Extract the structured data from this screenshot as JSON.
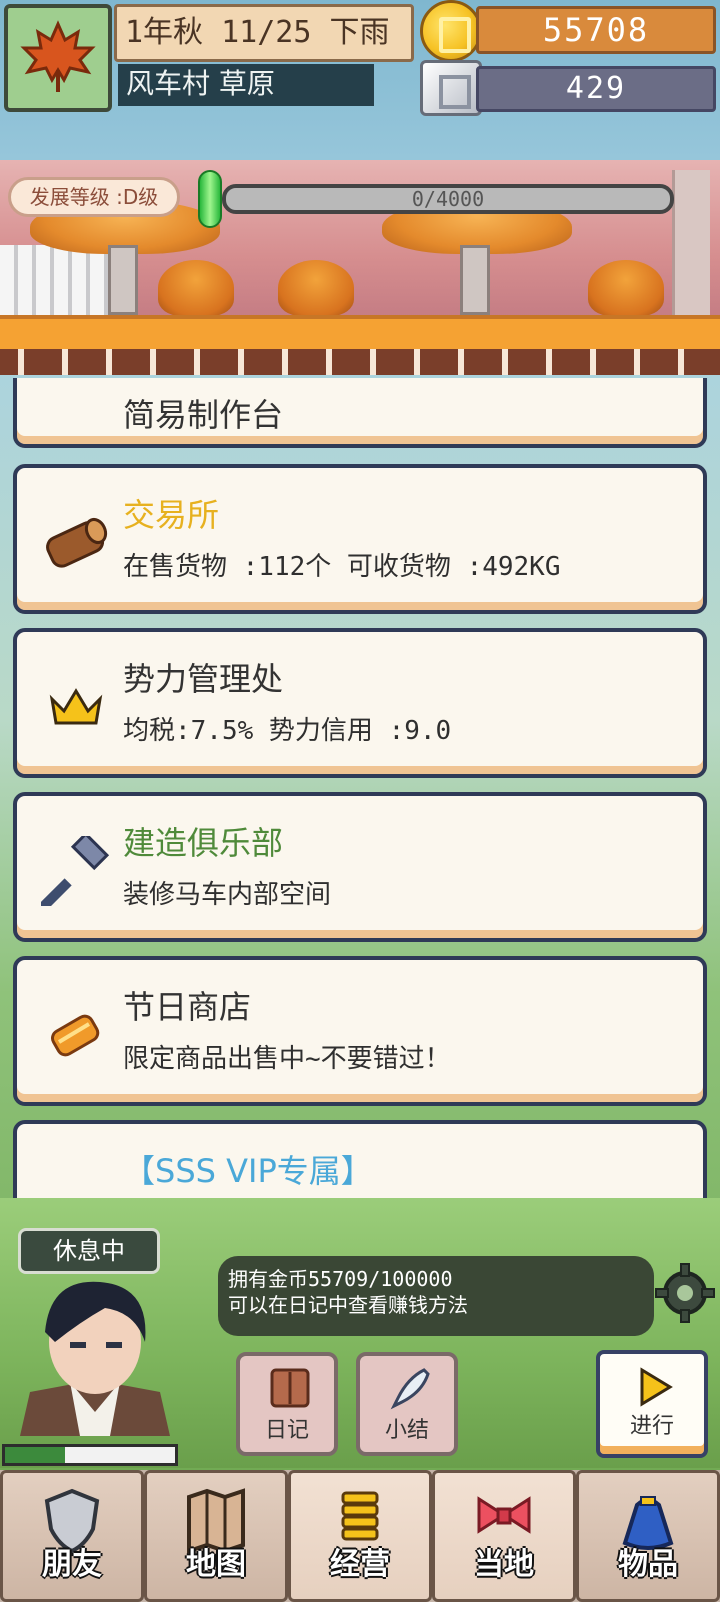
{
  "hud": {
    "date": "1年秋 11/25 下雨",
    "location": "风车村 草原",
    "gold": "55708",
    "silver": "429"
  },
  "development": {
    "label": "发展等级 :D级",
    "progress_text": "0/4000",
    "progress_fraction": 0
  },
  "buildings": [
    {
      "title": "简易制作台",
      "desc": ""
    },
    {
      "title": "交易所",
      "desc": "在售货物 :112个  可收货物 :492KG",
      "icon": "log-icon"
    },
    {
      "title": "势力管理处",
      "desc": "均税:7.5%  势力信用 :9.0",
      "icon": "crown-icon"
    },
    {
      "title": "建造俱乐部",
      "desc": "装修马车内部空间",
      "icon": "hammer-icon"
    },
    {
      "title": "节日商店",
      "desc": "限定商品出售中~不要错过！",
      "icon": "scroll-icon"
    },
    {
      "title": "【SSS VIP专属】",
      "desc": ""
    }
  ],
  "player": {
    "status": "休息中",
    "message_line1": "拥有金币55709/100000",
    "message_line2": "可以在日记中查看赚钱方法",
    "hp_fraction": 0.35
  },
  "actions": {
    "diary": "日记",
    "summary": "小结",
    "proceed": "进行"
  },
  "nav": [
    {
      "label": "朋友",
      "icon": "shield-icon"
    },
    {
      "label": "地图",
      "icon": "map-icon"
    },
    {
      "label": "经营",
      "icon": "coins-icon"
    },
    {
      "label": "当地",
      "icon": "bow-icon"
    },
    {
      "label": "物品",
      "icon": "bag-icon"
    }
  ],
  "colors": {
    "gold_bar": "#d98a3c",
    "silver_bar": "#6b6d86",
    "card_border": "#2f3a57",
    "title_gold": "#e7b11f",
    "title_green": "#4f8a3a",
    "title_blue": "#4aa8d8"
  }
}
